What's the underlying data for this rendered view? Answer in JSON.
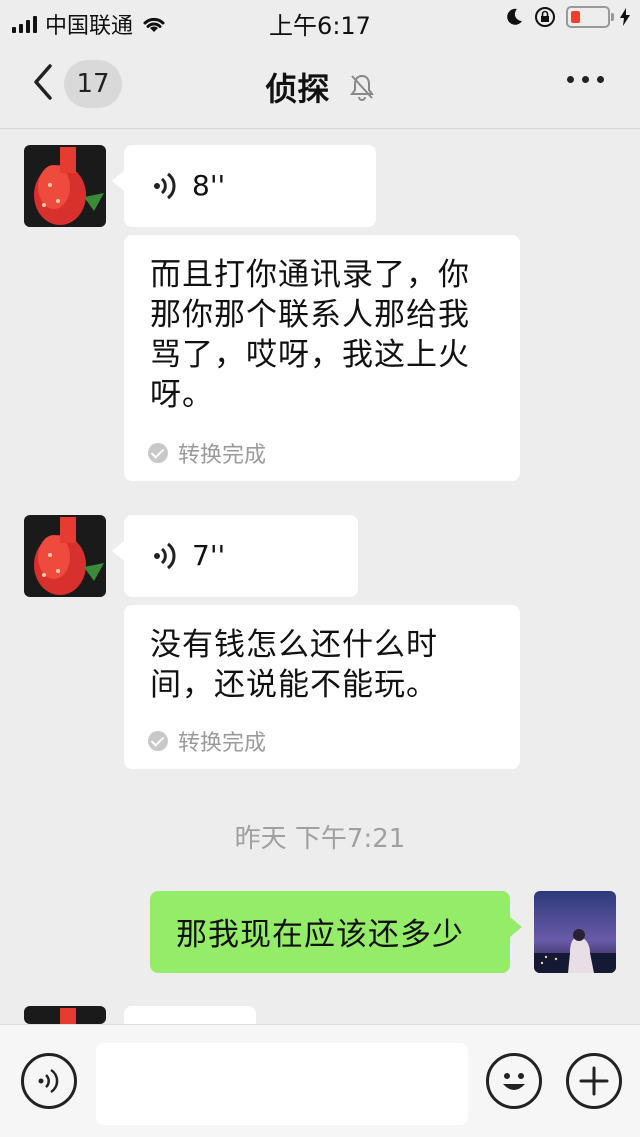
{
  "status_bar": {
    "carrier": "中国联通",
    "time": "上午6:17",
    "battery_color": "#ff3b30"
  },
  "nav": {
    "unread_count": "17",
    "title": "侦探",
    "mute_icon": "bell-slash-icon",
    "more_icon": "more-icon"
  },
  "messages": [
    {
      "type": "voice",
      "duration": "8''",
      "transcript": "而且打你通讯录了，你那你那个联系人那给我骂了，哎呀，我这上火呀。",
      "status": "转换完成"
    },
    {
      "type": "voice",
      "duration": "7''",
      "transcript": "没有钱怎么还什么时间，还说能不能玩。",
      "status": "转换完成"
    },
    {
      "type": "timestamp",
      "text": "昨天 下午7:21"
    },
    {
      "type": "text_sent",
      "text": "那我现在应该还多少"
    }
  ],
  "input_bar": {
    "voice_icon": "voice-mode-icon",
    "emoji_icon": "emoji-icon",
    "plus_icon": "plus-icon",
    "value": ""
  },
  "colors": {
    "background": "#ededed",
    "sent_bubble": "#95ec69",
    "received_bubble": "#ffffff"
  }
}
